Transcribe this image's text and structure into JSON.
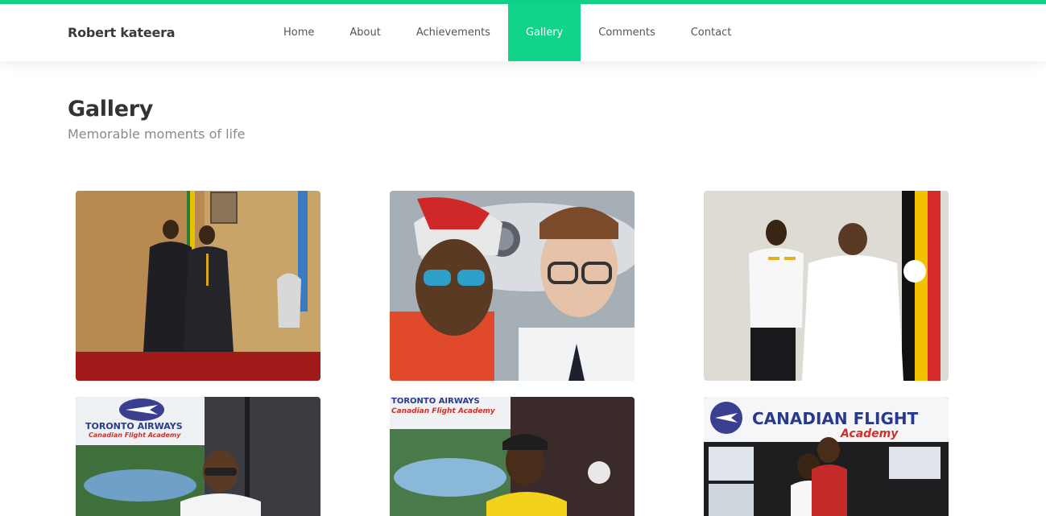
{
  "site": {
    "brand": "Robert kateera",
    "accent_color": "#10d48a"
  },
  "nav": {
    "items": [
      {
        "label": "Home",
        "active": false
      },
      {
        "label": "About",
        "active": false
      },
      {
        "label": "Achievements",
        "active": false
      },
      {
        "label": "Gallery",
        "active": true
      },
      {
        "label": "Comments",
        "active": false
      },
      {
        "label": "Contact",
        "active": false
      }
    ]
  },
  "gallery": {
    "title": "Gallery",
    "subtitle": "Memorable moments of life",
    "photos": [
      {
        "name": "photo-office-handshake"
      },
      {
        "name": "photo-selfie-jet"
      },
      {
        "name": "photo-pilot-flag"
      },
      {
        "name": "photo-toronto-airways",
        "sign_line1": "TORONTO AIRWAYS",
        "sign_line2": "Canadian Flight Academy"
      },
      {
        "name": "photo-toronto-airways-2",
        "sign_line1": "TORONTO AIRWAYS",
        "sign_line2": "Canadian Flight Academy"
      },
      {
        "name": "photo-canadian-flight-academy",
        "sign_line1": "CANADIAN FLIGHT",
        "sign_line2": "Academy"
      }
    ]
  }
}
